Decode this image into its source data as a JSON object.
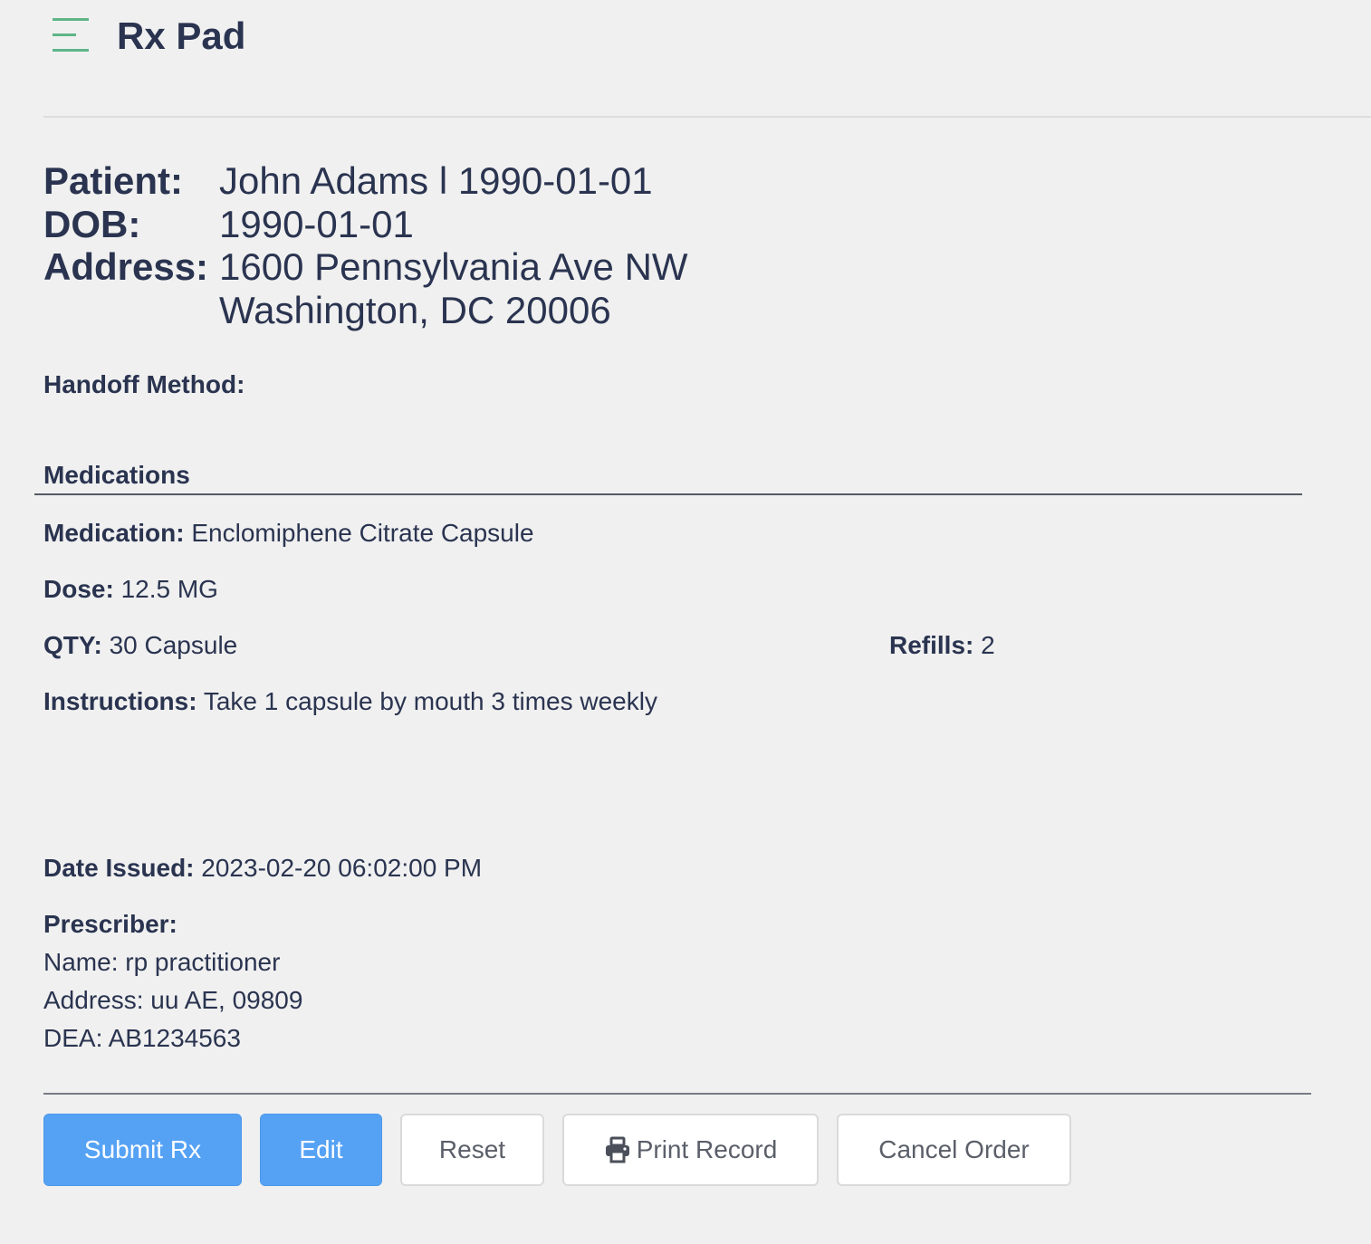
{
  "header": {
    "menu_icon": "hamburger-menu-icon",
    "title": "Rx Pad"
  },
  "patient": {
    "patient_label": "Patient:",
    "patient_value": "John Adams l 1990-01-01",
    "dob_label": "DOB:",
    "dob_value": "1990-01-01",
    "address_label": "Address:",
    "address_line1": "1600 Pennsylvania Ave NW",
    "address_line2": "Washington, DC 20006"
  },
  "handoff": {
    "label": "Handoff Method:",
    "value": ""
  },
  "medications": {
    "heading": "Medications",
    "medication_label": "Medication:",
    "medication_value": "Enclomiphene Citrate Capsule",
    "dose_label": "Dose:",
    "dose_value": "12.5 MG",
    "qty_label": "QTY:",
    "qty_value": "30 Capsule",
    "refills_label": "Refills:",
    "refills_value": "2",
    "instructions_label": "Instructions:",
    "instructions_value": "Take 1 capsule by mouth 3 times weekly"
  },
  "issued": {
    "label": "Date Issued:",
    "value": "2023-02-20 06:02:00 PM"
  },
  "prescriber": {
    "label": "Prescriber:",
    "name_line": "Name: rp practitioner",
    "address_line": "Address: uu AE, 09809",
    "dea_line": "DEA: AB1234563"
  },
  "actions": {
    "submit_label": "Submit Rx",
    "edit_label": "Edit",
    "reset_label": "Reset",
    "print_label": "Print Record",
    "print_icon": "printer-icon",
    "cancel_label": "Cancel Order"
  },
  "colors": {
    "primary_button": "#55a2f5",
    "text": "#2a3450",
    "menu_icon": "#5fb588",
    "background": "#f0f0f0"
  }
}
